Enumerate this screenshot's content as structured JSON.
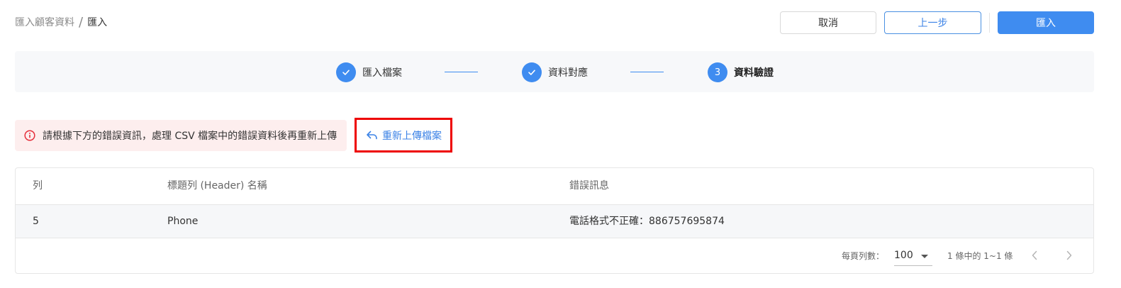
{
  "breadcrumb": {
    "parent": "匯入顧客資料",
    "separator": "/",
    "current": "匯入"
  },
  "actions": {
    "cancel": "取消",
    "previous": "上一步",
    "import": "匯入"
  },
  "stepper": {
    "steps": [
      {
        "label": "匯入檔案",
        "status": "done",
        "icon": "check-icon"
      },
      {
        "label": "資料對應",
        "status": "done",
        "icon": "check-icon"
      },
      {
        "label": "資料驗證",
        "status": "current",
        "number": "3"
      }
    ]
  },
  "alert": {
    "icon": "info-icon",
    "message": "請根據下方的錯誤資訊，處理 CSV 檔案中的錯誤資料後再重新上傳"
  },
  "reupload": {
    "icon": "reply-icon",
    "label": "重新上傳檔案"
  },
  "table": {
    "columns": [
      "列",
      "標題列 (Header) 名稱",
      "錯誤訊息"
    ],
    "rows": [
      [
        "5",
        "Phone",
        "電話格式不正確：886757695874"
      ]
    ]
  },
  "pagination": {
    "per_page_label": "每頁列數：",
    "per_page_value": "100",
    "range_text": "1 條中的 1~1 條"
  },
  "colors": {
    "primary": "#3f8cf0",
    "alert_bg": "#fdeeee",
    "alert_icon": "#e5303c",
    "highlight_border": "#ee0000"
  }
}
